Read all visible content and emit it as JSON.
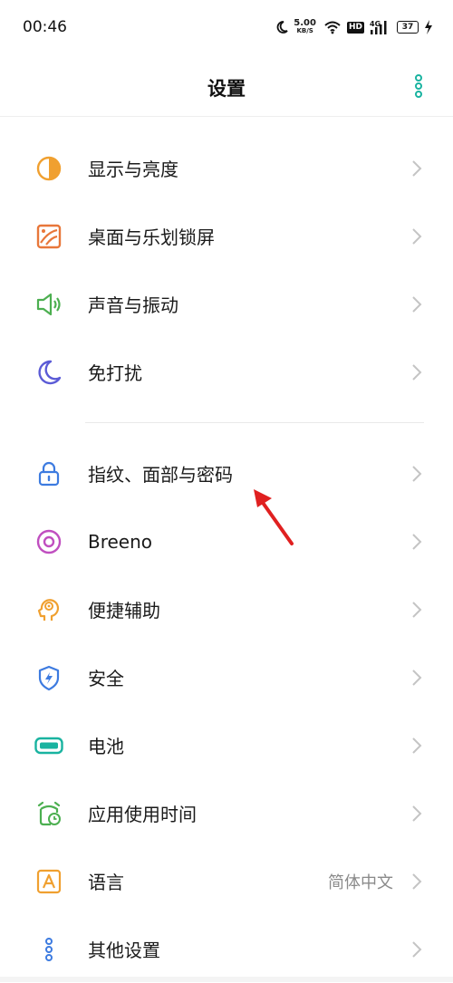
{
  "status_bar": {
    "time": "00:46",
    "net_speed_value": "5.00",
    "net_speed_unit": "KB/S",
    "hd_badge": "HD",
    "network_type": "4G",
    "battery_level": "37"
  },
  "header": {
    "title": "设置"
  },
  "settings": {
    "group1": [
      {
        "label": "显示与亮度",
        "icon": "display-brightness-icon",
        "color": "#F0A030"
      },
      {
        "label": "桌面与乐划锁屏",
        "icon": "wallpaper-icon",
        "color": "#E8773A"
      },
      {
        "label": "声音与振动",
        "icon": "speaker-icon",
        "color": "#4CAF50"
      },
      {
        "label": "免打扰",
        "icon": "moon-icon",
        "color": "#5B5BD6"
      }
    ],
    "group2": [
      {
        "label": "指纹、面部与密码",
        "icon": "lock-icon",
        "color": "#3D7BE0"
      },
      {
        "label": "Breeno",
        "icon": "breeno-icon",
        "color": "#C04FC0"
      },
      {
        "label": "便捷辅助",
        "icon": "assist-head-icon",
        "color": "#F0A030"
      },
      {
        "label": "安全",
        "icon": "shield-icon",
        "color": "#3D7BE0"
      },
      {
        "label": "电池",
        "icon": "battery-icon",
        "color": "#19B3A0"
      },
      {
        "label": "应用使用时间",
        "icon": "alarm-clock-icon",
        "color": "#4CAF50"
      },
      {
        "label": "语言",
        "value": "简体中文",
        "icon": "language-a-icon",
        "color": "#F0A030"
      },
      {
        "label": "其他设置",
        "icon": "more-settings-icon",
        "color": "#3D7BE0"
      }
    ]
  },
  "colors": {
    "accent": "#19B3A0",
    "annotation": "#E02020",
    "chevron": "#c4c4c4"
  }
}
